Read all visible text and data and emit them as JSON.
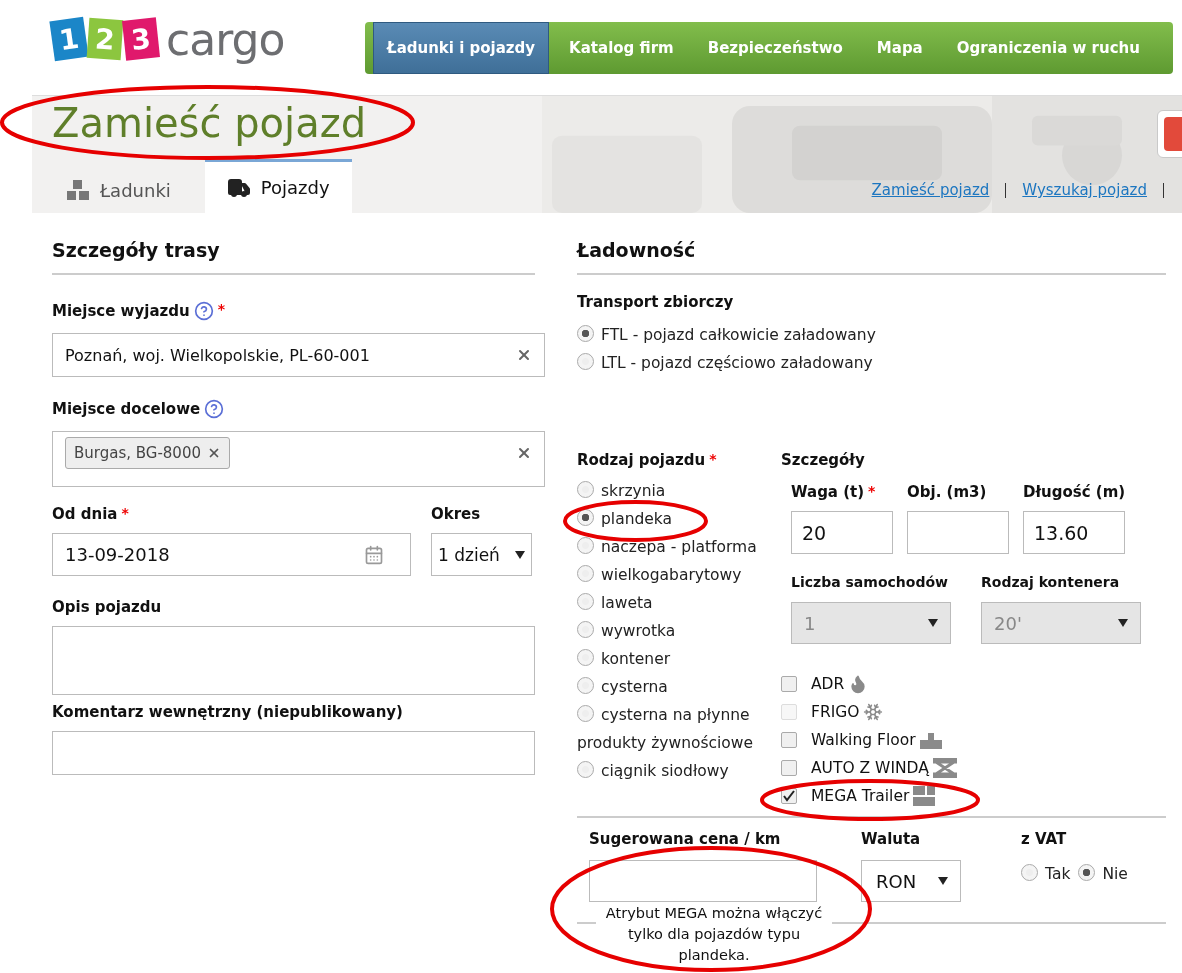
{
  "logo": {
    "digits": [
      "1",
      "2",
      "3"
    ],
    "word": "cargo"
  },
  "nav": [
    {
      "label": "Ładunki i pojazdy",
      "selected": true
    },
    {
      "label": "Katalog firm",
      "selected": false
    },
    {
      "label": "Bezpieczeństwo",
      "selected": false
    },
    {
      "label": "Mapa",
      "selected": false
    },
    {
      "label": "Ograniczenia w ruchu",
      "selected": false
    }
  ],
  "page_title": "Zamieść pojazd",
  "tabs": [
    {
      "label": "Ładunki",
      "selected": false,
      "kind": "boxes"
    },
    {
      "label": "Pojazdy",
      "selected": true,
      "kind": "truck"
    }
  ],
  "links": [
    "Zamieść pojazd",
    "Wyszukaj pojazd"
  ],
  "route": {
    "heading": "Szczegóły trasy",
    "departure": {
      "label": "Miejsce wyjazdu",
      "asterisk": "*",
      "value": "Poznań, woj. Wielkopolskie, PL-60-001"
    },
    "destination": {
      "label": "Miejsce docelowe",
      "tags": [
        "Burgas, BG-8000"
      ]
    },
    "date": {
      "label": "Od dnia",
      "asterisk": "*",
      "value": "13-09-2018"
    },
    "period": {
      "label": "Okres",
      "value": "1 dzień"
    },
    "description": {
      "label": "Opis pojazdu"
    },
    "comment": {
      "label": "Komentarz wewnętrzny (niepublikowany)"
    }
  },
  "capacity": {
    "heading": "Ładowność",
    "transport": {
      "label": "Transport zbiorczy",
      "options": [
        {
          "label": "FTL - pojazd całkowicie załadowany",
          "selected": true
        },
        {
          "label": "LTL - pojazd częściowo załadowany",
          "selected": false
        }
      ]
    },
    "vehicle_type": {
      "label": "Rodzaj pojazdu",
      "asterisk": "*",
      "options": [
        {
          "label": "skrzynia",
          "selected": false
        },
        {
          "label": "plandeka",
          "selected": true
        },
        {
          "label": "naczepa - platforma",
          "selected": false
        },
        {
          "label": "wielkogabarytowy",
          "selected": false
        },
        {
          "label": "laweta",
          "selected": false
        },
        {
          "label": "wywrotka",
          "selected": false
        },
        {
          "label": "kontener",
          "selected": false
        },
        {
          "label": "cysterna",
          "selected": false
        },
        {
          "label": "cysterna na płynne produkty żywnościowe",
          "selected": false
        },
        {
          "label": "ciągnik siodłowy",
          "selected": false
        }
      ]
    },
    "details": {
      "heading": "Szczegóły",
      "weight": {
        "label": "Waga (t)",
        "asterisk": "*",
        "value": "20"
      },
      "volume": {
        "label": "Obj. (m3)"
      },
      "length": {
        "label": "Długość (m)",
        "value": "13.60"
      },
      "vehicles": {
        "label": "Liczba samochodów",
        "value": "1",
        "disabled": true
      },
      "container": {
        "label": "Rodzaj kontenera",
        "value": "20'",
        "disabled": true
      }
    },
    "attributes": [
      {
        "label": "ADR",
        "checked": false,
        "disabled": false,
        "kind": "flame"
      },
      {
        "label": "FRIGO",
        "checked": false,
        "disabled": true,
        "kind": "snowflake"
      },
      {
        "label": "Walking Floor",
        "checked": false,
        "disabled": false,
        "kind": "floor"
      },
      {
        "label": "AUTO Z WINDĄ",
        "checked": false,
        "disabled": false,
        "kind": "lift"
      },
      {
        "label": "MEGA Trailer",
        "checked": true,
        "disabled": false,
        "kind": "mega"
      }
    ]
  },
  "price": {
    "label": "Sugerowana cena / km",
    "currency": {
      "label": "Waluta",
      "value": "RON"
    },
    "vat": {
      "label": "z VAT",
      "options": [
        {
          "label": "Tak",
          "selected": false
        },
        {
          "label": "Nie",
          "selected": true
        }
      ]
    }
  },
  "annotation": {
    "note": "Atrybut MEGA można włączyć tylko dla pojazdów typu plandeka."
  }
}
